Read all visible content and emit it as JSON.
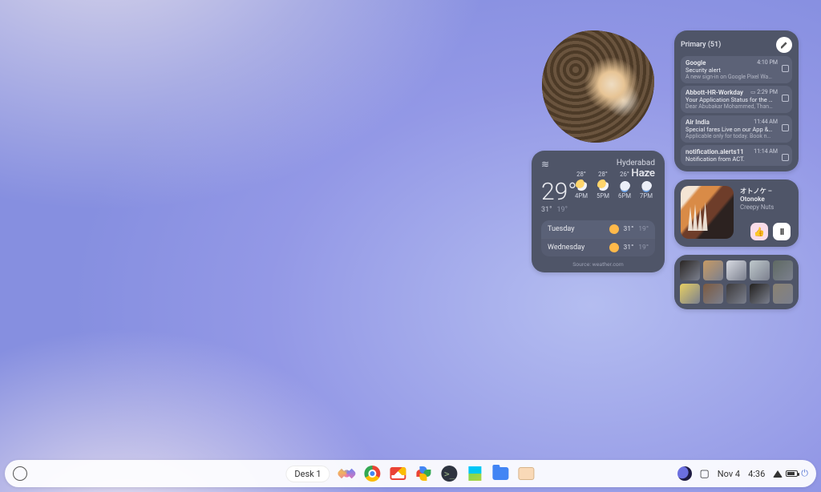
{
  "taskbar": {
    "desk_label": "Desk 1",
    "date": "Nov 4",
    "time": "4:36",
    "apps": [
      "ai",
      "chrome",
      "gmail",
      "photos",
      "terminal",
      "playstore",
      "files",
      "misc"
    ]
  },
  "photo_widget": {
    "alt": "Kitten sleeping on brown fur"
  },
  "gmail": {
    "header": "Primary (51)",
    "items": [
      {
        "sender": "Google",
        "subject": "Security alert",
        "preview": "A new sign-in on Google Pixel Watch 2 a...",
        "time": "4:10 PM",
        "promo": false
      },
      {
        "sender": "Abbott-HR-Workday",
        "subject": "Your Application Status for the Position...",
        "preview": "Dear Abubakar Mohammed, Thank you f...",
        "time": "2:29 PM",
        "promo": true
      },
      {
        "sender": "Air India",
        "subject": "Special fares Live on our App & Websi...",
        "preview": "Applicable only for today. Book now. 80...",
        "time": "11:44 AM",
        "promo": false
      },
      {
        "sender": "notification.alerts11",
        "subject": "Notification from ACT.",
        "preview": "",
        "time": "11:14 AM",
        "promo": false
      }
    ]
  },
  "weather": {
    "city": "Hyderabad",
    "condition": "Haze",
    "temp": "29°",
    "hi": "31°",
    "lo": "19°",
    "hourly": [
      {
        "t": "28°",
        "label": "4PM",
        "icon": "psun"
      },
      {
        "t": "28°",
        "label": "5PM",
        "icon": "psun"
      },
      {
        "t": "26°",
        "label": "6PM",
        "icon": "pcloud"
      },
      {
        "t": "27°",
        "label": "7PM",
        "icon": "pcloud"
      }
    ],
    "daily": [
      {
        "day": "Tuesday",
        "icon": "sun",
        "hi": "31°",
        "lo": "19°"
      },
      {
        "day": "Wednesday",
        "icon": "sun",
        "hi": "31°",
        "lo": "19°"
      }
    ],
    "source": "Source: weather.com"
  },
  "music": {
    "title": "オトノケ – Otonoke",
    "artist": "Creepy Nuts"
  },
  "photos_grid": {
    "items": [
      "#2a2624",
      "#c79a64",
      "#d8dbe2",
      "#bfc9cc",
      "#5f6a63",
      "#e7cf63",
      "#7d5a40",
      "#3c3a3b",
      "#22201e",
      "#8a8272"
    ]
  }
}
